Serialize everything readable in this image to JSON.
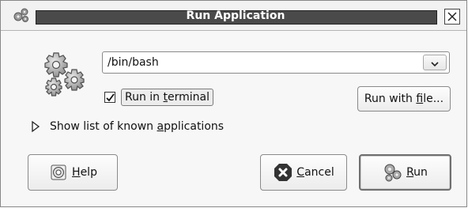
{
  "window": {
    "title": "Run Application",
    "app_icon": "gears-small-icon",
    "close_icon": "close-icon"
  },
  "command": {
    "value": "/bin/bash",
    "dropdown_icon": "chevron-down-icon"
  },
  "run_in_terminal": {
    "checked": true,
    "label_pre": "Run in ",
    "label_mnemonic": "t",
    "label_post": "erminal"
  },
  "run_with_file": {
    "label_pre": "Run with ",
    "label_mnemonic": "f",
    "label_post": "ile..."
  },
  "expander": {
    "label_pre": "Show list of known ",
    "label_mnemonic": "a",
    "label_post": "pplications",
    "expanded": false
  },
  "buttons": {
    "help": {
      "mnemonic": "H",
      "rest": "elp",
      "icon": "help-icon"
    },
    "cancel": {
      "mnemonic": "C",
      "rest": "ancel",
      "icon": "cancel-icon"
    },
    "run": {
      "mnemonic": "R",
      "rest": "un",
      "icon": "gears-run-icon"
    }
  }
}
